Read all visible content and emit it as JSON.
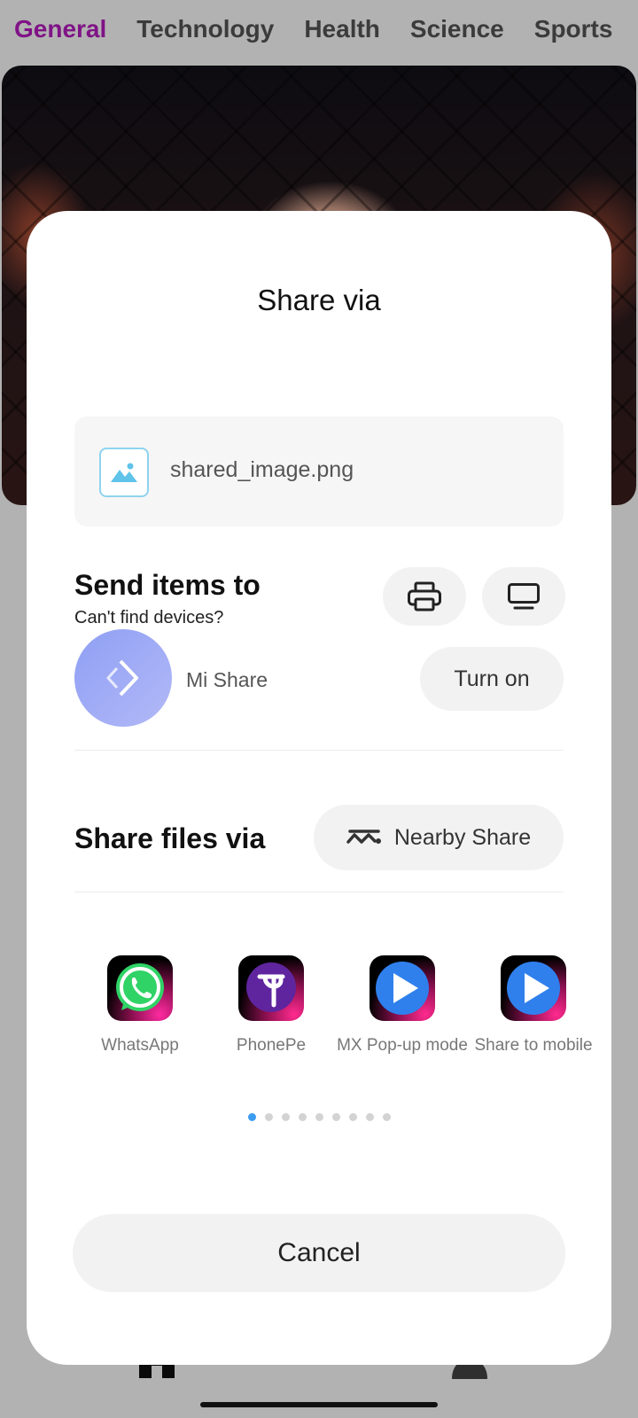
{
  "tabs": [
    {
      "label": "General",
      "active": true
    },
    {
      "label": "Technology",
      "active": false
    },
    {
      "label": "Health",
      "active": false
    },
    {
      "label": "Science",
      "active": false
    },
    {
      "label": "Sports",
      "active": false
    }
  ],
  "colors": {
    "active_tab": "#b71cc1",
    "accent_dot": "#3c9cf0",
    "mishare_gradient_start": "#8f9ff4",
    "mishare_gradient_end": "#b2b9f7"
  },
  "share_sheet": {
    "title": "Share via",
    "file": {
      "name": "shared_image.png",
      "icon": "image-icon"
    },
    "send_items": {
      "title": "Send items to",
      "subtitle": "Can't find devices?",
      "print_icon": "printer-icon",
      "screen_icon": "monitor-icon",
      "mi_share_label": "Mi Share",
      "turn_on_label": "Turn on"
    },
    "share_files": {
      "title": "Share files via",
      "nearby_label": "Nearby Share",
      "nearby_icon": "nearby-share-icon"
    },
    "apps": [
      {
        "label": "WhatsApp",
        "icon": "whatsapp-icon"
      },
      {
        "label": "PhonePe",
        "icon": "phonepe-icon"
      },
      {
        "label": "MX Pop-up mode",
        "icon": "mx-player-icon"
      },
      {
        "label": "Share to mobile",
        "icon": "mx-player-icon"
      }
    ],
    "pager": {
      "page": 1,
      "total": 9
    },
    "cancel_label": "Cancel"
  }
}
